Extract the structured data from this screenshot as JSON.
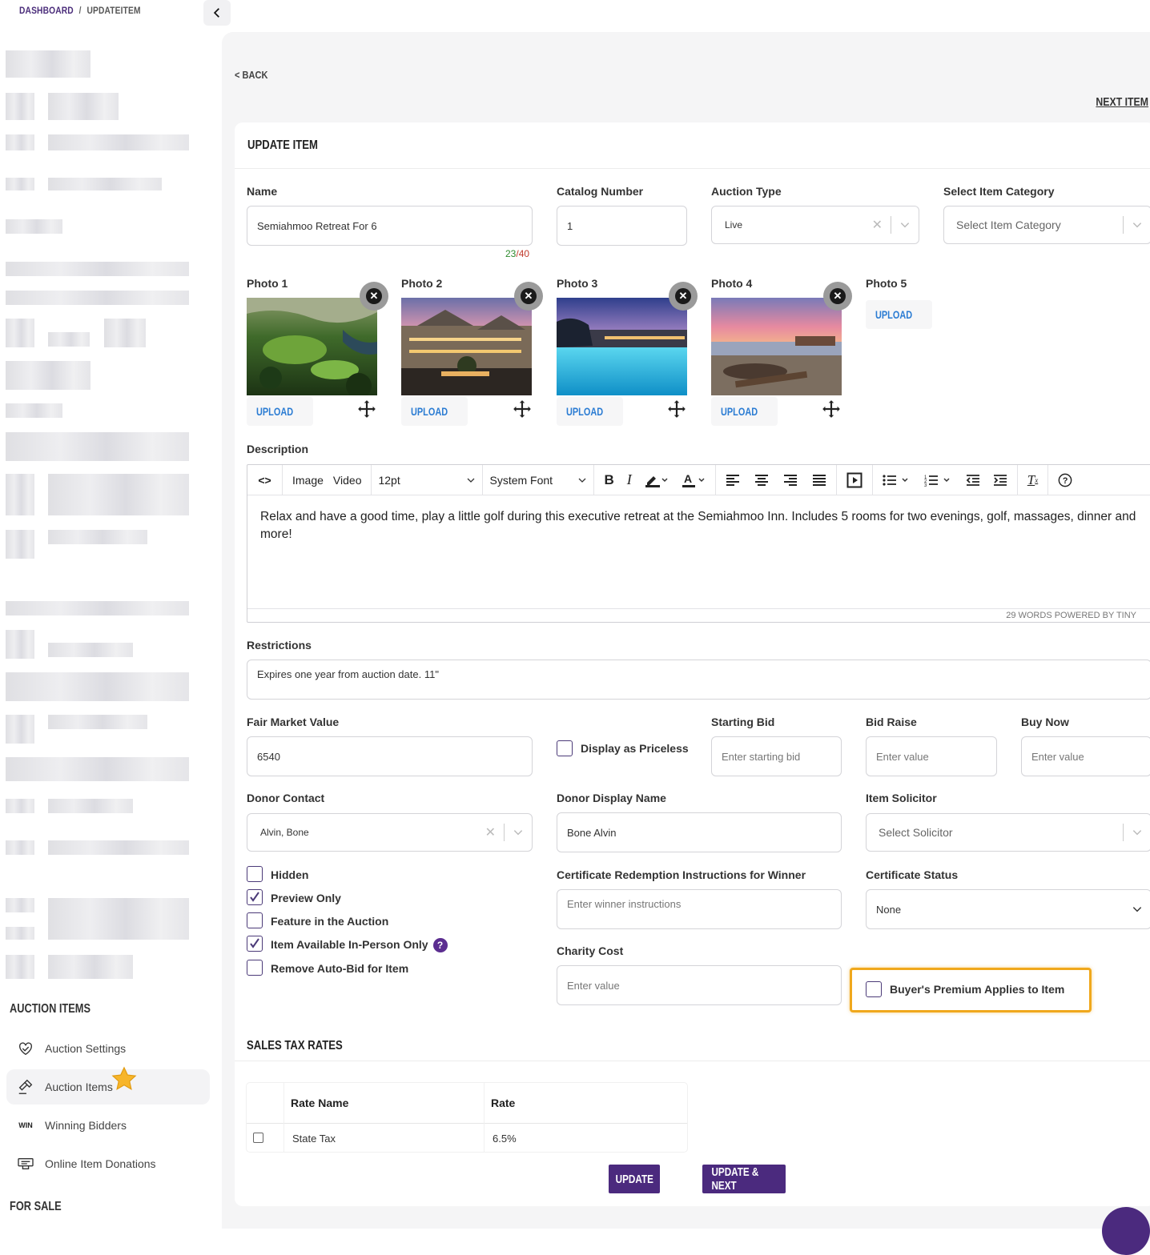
{
  "breadcrumb": {
    "root": "DASHBOARD",
    "separator": "/",
    "current": "UPDATEITEM"
  },
  "sidebar": {
    "section_auction": "AUCTION ITEMS",
    "items": [
      {
        "label": "Auction Settings",
        "icon": "handshake-icon"
      },
      {
        "label": "Auction Items",
        "icon": "gavel-icon"
      },
      {
        "label": "Winning Bidders",
        "icon": "win-icon",
        "icon_text": "WIN"
      },
      {
        "label": "Online Item Donations",
        "icon": "donation-icon"
      }
    ],
    "section_sale": "FOR SALE"
  },
  "nav": {
    "back": "< BACK",
    "next": "NEXT ITEM"
  },
  "form": {
    "title": "UPDATE ITEM",
    "name": {
      "label": "Name",
      "value": "Semiahmoo Retreat For 6",
      "count": "23",
      "max": "/40"
    },
    "catalog": {
      "label": "Catalog Number",
      "value": "1"
    },
    "auction_type": {
      "label": "Auction Type",
      "value": "Live"
    },
    "category": {
      "label": "Select Item Category",
      "placeholder": "Select Item Category"
    },
    "photos": [
      {
        "label": "Photo 1",
        "upload": "UPLOAD"
      },
      {
        "label": "Photo 2",
        "upload": "UPLOAD"
      },
      {
        "label": "Photo 3",
        "upload": "UPLOAD"
      },
      {
        "label": "Photo 4",
        "upload": "UPLOAD"
      },
      {
        "label": "Photo 5",
        "upload": "UPLOAD"
      }
    ],
    "description": {
      "label": "Description",
      "toolbar": {
        "image": "Image",
        "video": "Video",
        "size": "12pt",
        "font": "System Font"
      },
      "text": "Relax and have a good time, play a little golf during this executive retreat at the Semiahmoo Inn. Includes 5 rooms for two evenings, golf, massages, dinner and more!",
      "status": "29 WORDS  POWERED BY TINY"
    },
    "restrictions": {
      "label": "Restrictions",
      "value": "Expires one year from auction date.  11\""
    },
    "fmv": {
      "label": "Fair Market Value",
      "value": "6540"
    },
    "priceless": {
      "label": "Display as Priceless"
    },
    "starting_bid": {
      "label": "Starting Bid",
      "placeholder": "Enter starting bid"
    },
    "bid_raise": {
      "label": "Bid Raise",
      "placeholder": "Enter value"
    },
    "buy_now": {
      "label": "Buy Now",
      "placeholder": "Enter value"
    },
    "donor_contact": {
      "label": "Donor Contact",
      "value": "Alvin, Bone"
    },
    "donor_display": {
      "label": "Donor Display Name",
      "value": "Bone Alvin"
    },
    "solicitor": {
      "label": "Item Solicitor",
      "placeholder": "Select Solicitor"
    },
    "checkboxes": [
      {
        "label": "Hidden",
        "checked": false
      },
      {
        "label": "Preview Only",
        "checked": true
      },
      {
        "label": "Feature in the Auction",
        "checked": false
      },
      {
        "label": "Item Available In-Person Only",
        "checked": true
      },
      {
        "label": "Remove Auto-Bid for Item",
        "checked": false
      }
    ],
    "cert_instructions": {
      "label": "Certificate Redemption Instructions for Winner",
      "placeholder": "Enter winner instructions"
    },
    "cert_status": {
      "label": "Certificate Status",
      "value": "None"
    },
    "charity_cost": {
      "label": "Charity Cost",
      "placeholder": "Enter value"
    },
    "buyers_premium": {
      "label": "Buyer's Premium Applies to Item",
      "checked": false
    },
    "tax": {
      "title": "SALES TAX RATES",
      "columns": [
        "Rate Name",
        "Rate"
      ],
      "rows": [
        {
          "name": "State Tax",
          "rate": "6.5%"
        }
      ]
    },
    "buttons": {
      "update": "UPDATE",
      "update_next": "UPDATE & NEXT"
    }
  },
  "colors": {
    "brand": "#4b2a7e",
    "link": "#2b7cd3",
    "highlight": "#f0a81c"
  }
}
